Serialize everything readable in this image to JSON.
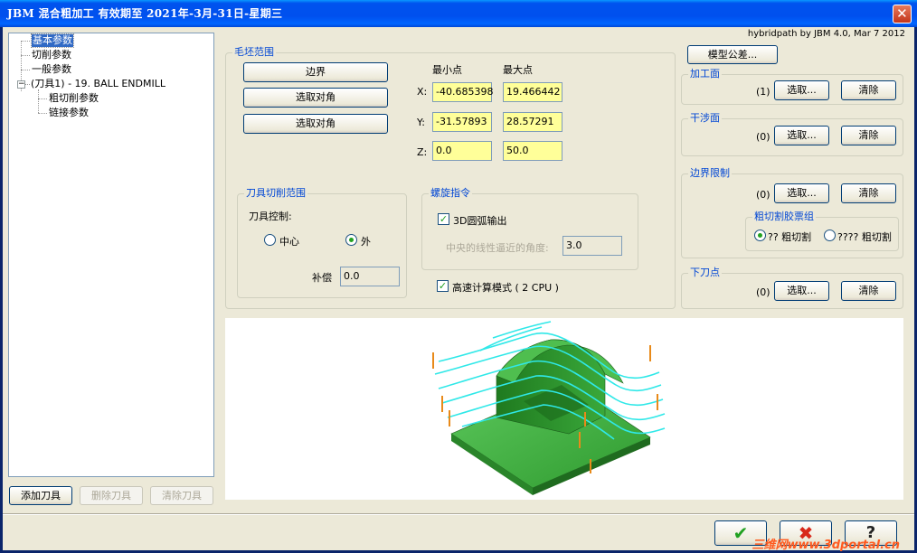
{
  "window": {
    "title": "JBM  混合粗加工  有效期至  2021年-3月-31日-星期三",
    "close_label": "✕"
  },
  "version": "hybridpath by JBM 4.0, Mar  7 2012",
  "tree": {
    "items": [
      {
        "label": "基本参数"
      },
      {
        "label": "切削参数"
      },
      {
        "label": "一般参数"
      },
      {
        "label": "(刀具1) -     19. BALL ENDMILL"
      },
      {
        "label": "粗切削参数"
      },
      {
        "label": "链接参数"
      }
    ],
    "expander": "−"
  },
  "tool_buttons": {
    "add": "添加刀具",
    "delete": "删除刀具",
    "clear": "清除刀具"
  },
  "blank_range": {
    "title": "毛坯范围",
    "buttons": {
      "boundary": "边界",
      "corner1": "选取对角",
      "corner2": "选取对角"
    },
    "headers": {
      "min": "最小点",
      "max": "最大点"
    },
    "rows": [
      {
        "axis": "X:",
        "min": "-40.685398",
        "max": "19.466442"
      },
      {
        "axis": "Y:",
        "min": "-31.57893",
        "max": "28.57291"
      },
      {
        "axis": "Z:",
        "min": "0.0",
        "max": "50.0"
      }
    ]
  },
  "tool_range": {
    "title": "刀具切削范围",
    "control_label": "刀具控制:",
    "center": "中心",
    "outside": "外",
    "selected": "outside",
    "offset_label": "补偿",
    "offset_value": "0.0"
  },
  "helix": {
    "title": "螺旋指令",
    "arc_label": "3D圆弧输出",
    "arc_checked": true,
    "angle_label": "中央的线性逼近的角度:",
    "angle_value": "3.0"
  },
  "fast_mode": {
    "label": "高速计算模式  ( 2 CPU )",
    "checked": true
  },
  "tolerance_button": "模型公差...",
  "machining": {
    "title": "加工面",
    "count": "(1)",
    "select": "选取...",
    "clear": "清除"
  },
  "interference": {
    "title": "干涉面",
    "count": "(0)",
    "select": "选取...",
    "clear": "清除"
  },
  "boundary_limit": {
    "title": "边界限制",
    "count": "(0)",
    "select": "选取...",
    "clear": "清除",
    "subgroup_title": "粗切割胶票组",
    "option1": "?? 粗切割",
    "option2": "???? 粗切割",
    "selected": "option1"
  },
  "entry": {
    "title": "下刀点",
    "count": "(0)",
    "select": "选取...",
    "clear": "清除"
  },
  "footer": {
    "ok_icon": "✔",
    "cancel_icon": "✖",
    "help_icon": "?",
    "watermark": "三维网www.3dportal.cn"
  },
  "colors": {
    "title_bar": "#0053ee",
    "highlight_field": "#ffff99",
    "group_title": "#0046d5",
    "model": "#2f9a2f",
    "toolpath": "#2fe8e8",
    "tool_marker": "#e88a1a"
  }
}
